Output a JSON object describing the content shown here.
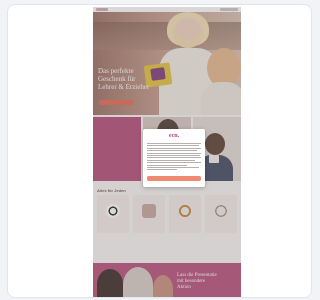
{
  "hero": {
    "title_line1": "Das perfekte",
    "title_line2": "Geschenk für",
    "title_line3": "Lehrer & Erzieher",
    "cta": ""
  },
  "feature": {
    "panel_lines": [
      "",
      "",
      "",
      ""
    ]
  },
  "categories": {
    "title": "Alles für Jeden",
    "items": [
      {
        "label": "",
        "icon": "ball-icon"
      },
      {
        "label": "",
        "icon": "gift-box-icon"
      },
      {
        "label": "",
        "icon": "rings-icon"
      },
      {
        "label": "",
        "icon": "glasses-icon"
      }
    ],
    "more": ""
  },
  "banner": {
    "line1": "Lass die Presentatie",
    "line2": "mit besondere",
    "line3": "Aktion"
  },
  "modal": {
    "logo": "ecn.",
    "accept": ""
  },
  "colors": {
    "accent_pink": "#b34b76",
    "cta_orange": "#e8694f",
    "modal_button": "#ef8a70"
  }
}
